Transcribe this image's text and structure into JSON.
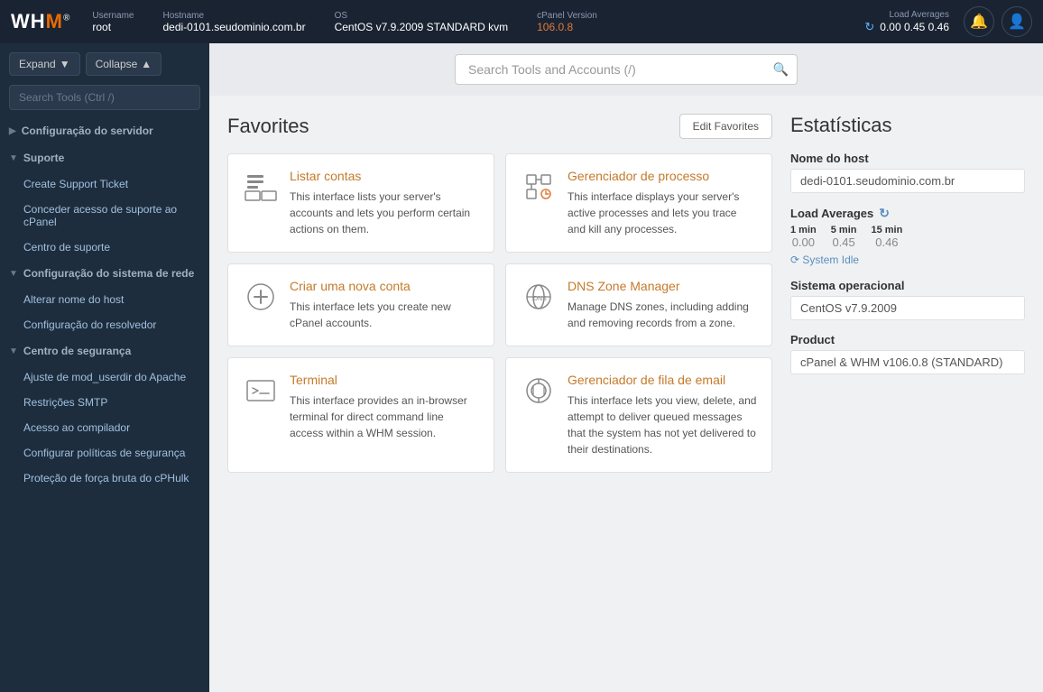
{
  "logo": {
    "text": "WHM",
    "tm": "®"
  },
  "topbar": {
    "username_label": "Username",
    "username_value": "root",
    "hostname_label": "Hostname",
    "hostname_value": "dedi-0101.seudominio.com.br",
    "os_label": "OS",
    "os_value": "CentOS v7.9.2009 STANDARD kvm",
    "cpanel_label": "cPanel Version",
    "cpanel_value": "106.0.8",
    "load_label": "Load Averages",
    "load_icon": "↻",
    "load_values": "0.00  0.45  0.46"
  },
  "sidebar": {
    "expand_label": "Expand",
    "collapse_label": "Collapse",
    "search_placeholder": "Search Tools (Ctrl /)",
    "sections": [
      {
        "id": "configuracao-servidor",
        "label": "Configuração do servidor",
        "expanded": false,
        "items": []
      },
      {
        "id": "suporte",
        "label": "Suporte",
        "expanded": true,
        "items": [
          "Create Support Ticket",
          "Conceder acesso de suporte ao cPanel",
          "Centro de suporte"
        ]
      },
      {
        "id": "configuracao-rede",
        "label": "Configuração do sistema de rede",
        "expanded": true,
        "items": [
          "Alterar nome do host",
          "Configuração do resolvedor"
        ]
      },
      {
        "id": "centro-seguranca",
        "label": "Centro de segurança",
        "expanded": true,
        "items": [
          "Ajuste de mod_userdir do Apache",
          "Restrições SMTP",
          "Acesso ao compilador",
          "Configurar políticas de segurança",
          "Proteção de força bruta do cPHulk"
        ]
      }
    ]
  },
  "search": {
    "placeholder": "Search Tools and Accounts (/)"
  },
  "favorites": {
    "title": "Favorites",
    "edit_button": "Edit Favorites",
    "cards": [
      {
        "id": "listar-contas",
        "title": "Listar contas",
        "description": "This interface lists your server's accounts and lets you perform certain actions on them.",
        "icon_type": "list"
      },
      {
        "id": "gerenciador-processo",
        "title": "Gerenciador de processo",
        "description": "This interface displays your server's active processes and lets you trace and kill any processes.",
        "icon_type": "process"
      },
      {
        "id": "criar-conta",
        "title": "Criar uma nova conta",
        "description": "This interface lets you create new cPanel accounts.",
        "icon_type": "add"
      },
      {
        "id": "dns-zone",
        "title": "DNS Zone Manager",
        "description": "Manage DNS zones, including adding and removing records from a zone.",
        "icon_type": "dns"
      },
      {
        "id": "terminal",
        "title": "Terminal",
        "description": "This interface provides an in-browser terminal for direct command line access within a WHM session.",
        "icon_type": "terminal"
      },
      {
        "id": "fila-email",
        "title": "Gerenciador de fila de email",
        "description": "This interface lets you view, delete, and attempt to deliver queued messages that the system has not yet delivered to their destinations.",
        "icon_type": "email"
      }
    ]
  },
  "stats": {
    "title": "Estatísticas",
    "hostname_label": "Nome do host",
    "hostname_value": "dedi-0101.seudominio.com.br",
    "load_label": "Load Averages",
    "load_refresh_icon": "↻",
    "load_1min_label": "1 min",
    "load_5min_label": "5 min",
    "load_15min_label": "15 min",
    "load_1min_value": "0.00",
    "load_5min_value": "0.45",
    "load_15min_value": "0.46",
    "system_idle_label": "⟳ System Idle",
    "os_label": "Sistema operacional",
    "os_value": "CentOS v7.9.2009",
    "product_label": "Product",
    "product_value": "cPanel & WHM v106.0.8 (STANDARD)"
  }
}
